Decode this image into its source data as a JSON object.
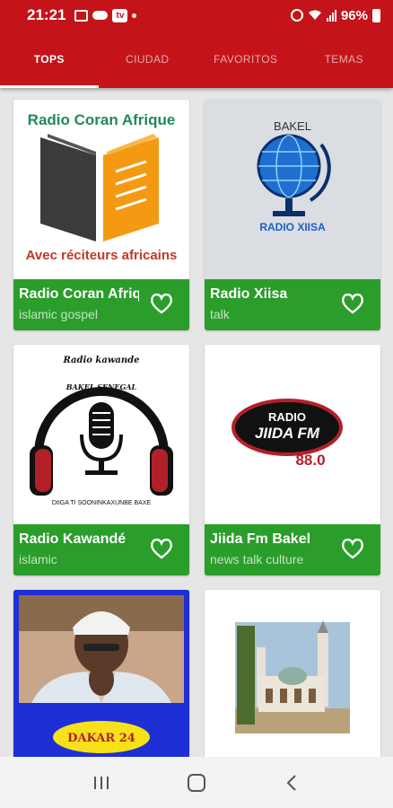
{
  "status_bar": {
    "time": "21:21",
    "battery_text": "96%",
    "left_icons": [
      "image-icon",
      "cloud-icon",
      "tv-app-icon",
      "notification-dot-icon"
    ],
    "right_icons": [
      "alarm-icon",
      "wifi-icon",
      "signal-icon",
      "battery-icon"
    ]
  },
  "tabs": [
    {
      "label": "TOPS",
      "active": true
    },
    {
      "label": "CIUDAD",
      "active": false
    },
    {
      "label": "FAVORITOS",
      "active": false
    },
    {
      "label": "TEMAS",
      "active": false
    }
  ],
  "cards": [
    {
      "title": "Radio Coran Afrique",
      "tag": "islamic gospel",
      "logo_top": "Radio Coran Afrique",
      "logo_bottom": "Avec réciteurs africains"
    },
    {
      "title": "Radio Xiisa",
      "tag": "talk",
      "logo_top": "BAKEL",
      "logo_bottom": "RADIO XIISA"
    },
    {
      "title": "Radio Kawandé",
      "tag": "islamic",
      "logo_top": "Radio kawande",
      "logo_arc": "BAKEL SENEGAL",
      "logo_bottom": "DIIGA TI SOONINKAXUNBE BAXE"
    },
    {
      "title": "Jiida Fm Bakel",
      "tag": "news talk culture",
      "logo_top": "RADIO",
      "logo_mid": "JIIDA FM",
      "logo_bottom": "88.0"
    },
    {
      "title": "",
      "tag": "",
      "logo_bottom": "DAKAR 24"
    },
    {
      "title": "",
      "tag": ""
    }
  ],
  "colors": {
    "primary_red": "#c4141a",
    "card_green": "#2a9d2a",
    "selection_blue": "#1533d6"
  },
  "nav": [
    "recent-apps-icon",
    "home-icon",
    "back-icon"
  ]
}
